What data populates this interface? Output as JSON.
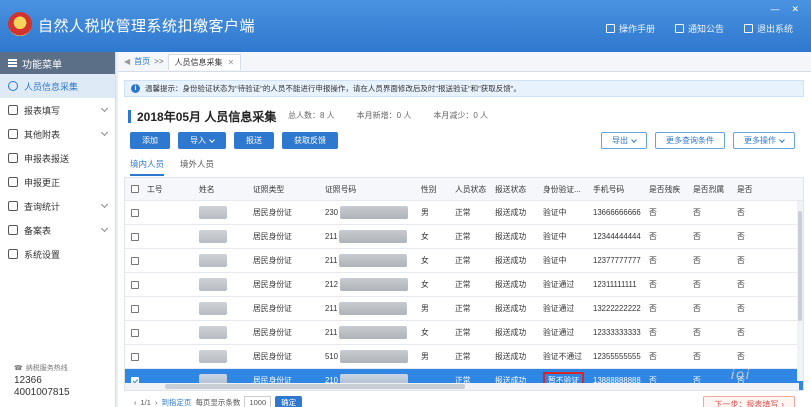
{
  "app": {
    "title": "自然人税收管理系统扣缴客户端",
    "actions": [
      {
        "label": "操作手册",
        "icon": "book-icon"
      },
      {
        "label": "通知公告",
        "icon": "bell-icon"
      },
      {
        "label": "退出系统",
        "icon": "power-icon"
      }
    ]
  },
  "sidebar": {
    "header": "功能菜单",
    "items": [
      {
        "label": "人员信息采集",
        "icon": "user-icon",
        "active": true,
        "caret": false
      },
      {
        "label": "报表填写",
        "icon": "edit-icon",
        "active": false,
        "caret": true
      },
      {
        "label": "其他附表",
        "icon": "grid-icon",
        "active": false,
        "caret": true
      },
      {
        "label": "申报表报送",
        "icon": "send-icon",
        "active": false,
        "caret": false
      },
      {
        "label": "申报更正",
        "icon": "search-icon",
        "active": false,
        "caret": false
      },
      {
        "label": "查询统计",
        "icon": "chart-icon",
        "active": false,
        "caret": true
      },
      {
        "label": "备案表",
        "icon": "file-icon",
        "active": false,
        "caret": true
      },
      {
        "label": "系统设置",
        "icon": "gear-icon",
        "active": false,
        "caret": false
      }
    ],
    "hotline": {
      "label": "纳税服务热线",
      "numbers": [
        "12366",
        "4001007815"
      ]
    }
  },
  "tabbar": {
    "home": "首页",
    "sep": ">>",
    "tab": "人员信息采集"
  },
  "notice": "温馨提示：身份验证状态为\"待验证\"的人员不能进行申报操作，请在人员界面修改后及时\"报送验证\"和\"获取反馈\"。",
  "heading": {
    "title": "2018年05月  人员信息采集"
  },
  "stats": [
    {
      "label": "总人数：",
      "value": "8 人"
    },
    {
      "label": "本月新增：",
      "value": "0 人"
    },
    {
      "label": "本月减少：",
      "value": "0 人"
    }
  ],
  "buttons": {
    "add": "添加",
    "import": "导入",
    "submit": "报送",
    "feedback": "获取反馈",
    "export": "导出",
    "more_query": "更多查询条件",
    "more_ops": "更多操作"
  },
  "subtabs": [
    "境内人员",
    "境外人员"
  ],
  "table": {
    "columns": [
      "工号",
      "姓名",
      "证照类型",
      "证照号码",
      "性别",
      "人员状态",
      "报送状态",
      "身份验证...",
      "手机号码",
      "是否残疾",
      "是否烈属",
      "是否"
    ],
    "rows": [
      {
        "id_type": "居民身份证",
        "id_prefix": "230",
        "gender": "男",
        "status": "正常",
        "submit": "报送成功",
        "verify": "验证中",
        "phone": "13666666666",
        "d": "否",
        "m": "否",
        "x": "否",
        "selected": false
      },
      {
        "id_type": "居民身份证",
        "id_prefix": "211",
        "gender": "女",
        "status": "正常",
        "submit": "报送成功",
        "verify": "验证中",
        "phone": "12344444444",
        "d": "否",
        "m": "否",
        "x": "否",
        "selected": false
      },
      {
        "id_type": "居民身份证",
        "id_prefix": "211",
        "gender": "女",
        "status": "正常",
        "submit": "报送成功",
        "verify": "验证中",
        "phone": "12377777777",
        "d": "否",
        "m": "否",
        "x": "否",
        "selected": false
      },
      {
        "id_type": "居民身份证",
        "id_prefix": "212",
        "gender": "女",
        "status": "正常",
        "submit": "报送成功",
        "verify": "验证通过",
        "phone": "12311111111",
        "d": "否",
        "m": "否",
        "x": "否",
        "selected": false
      },
      {
        "id_type": "居民身份证",
        "id_prefix": "211",
        "gender": "男",
        "status": "正常",
        "submit": "报送成功",
        "verify": "验证通过",
        "phone": "13222222222",
        "d": "否",
        "m": "否",
        "x": "否",
        "selected": false
      },
      {
        "id_type": "居民身份证",
        "id_prefix": "211",
        "gender": "女",
        "status": "正常",
        "submit": "报送成功",
        "verify": "验证通过",
        "phone": "12333333333",
        "d": "否",
        "m": "否",
        "x": "否",
        "selected": false
      },
      {
        "id_type": "居民身份证",
        "id_prefix": "510",
        "gender": "男",
        "status": "正常",
        "submit": "报送成功",
        "verify": "验证不通过",
        "phone": "12355555555",
        "d": "否",
        "m": "否",
        "x": "否",
        "selected": false
      },
      {
        "id_type": "居民身份证",
        "id_prefix": "210",
        "gender": "",
        "status": "正常",
        "submit": "报送成功",
        "verify": "暂不验证",
        "phone": "13888888888",
        "d": "否",
        "m": "否",
        "x": "否",
        "selected": true
      }
    ]
  },
  "pager": {
    "prefix": "‹",
    "page": "1/1",
    "next": "›",
    "jump_label": "到指定页",
    "per_page_label": "每页显示条数",
    "per_page": "1000",
    "go": "确定"
  },
  "next_btn": "下一步：报表填写",
  "watermark": "ioi"
}
